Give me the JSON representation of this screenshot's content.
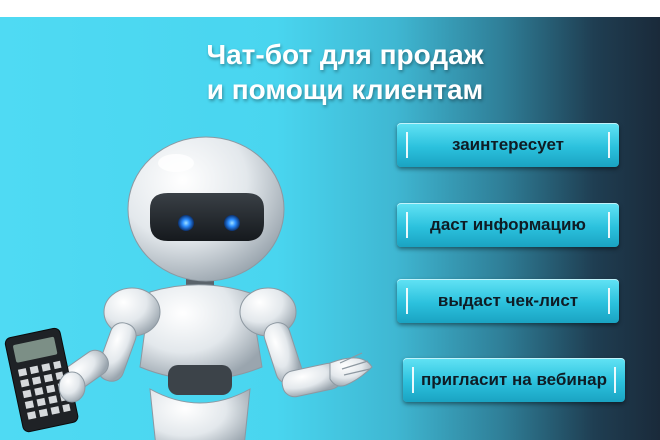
{
  "banner": {
    "title_line1": "Чат-бот для продаж",
    "title_line2": "и помощи клиентам"
  },
  "features": [
    {
      "label": "заинтересует"
    },
    {
      "label": "даст информацию"
    },
    {
      "label": "выдаст чек-лист"
    },
    {
      "label": "пригласит на вебинар"
    }
  ],
  "colors": {
    "background_start": "#4fdaf3",
    "background_end": "#1a2a3a",
    "button_fill": "#2bc1dd",
    "title_text": "#ffffff",
    "robot_eyes": "#2a8cff"
  },
  "illustration": {
    "subject": "robot-holding-calculator"
  }
}
